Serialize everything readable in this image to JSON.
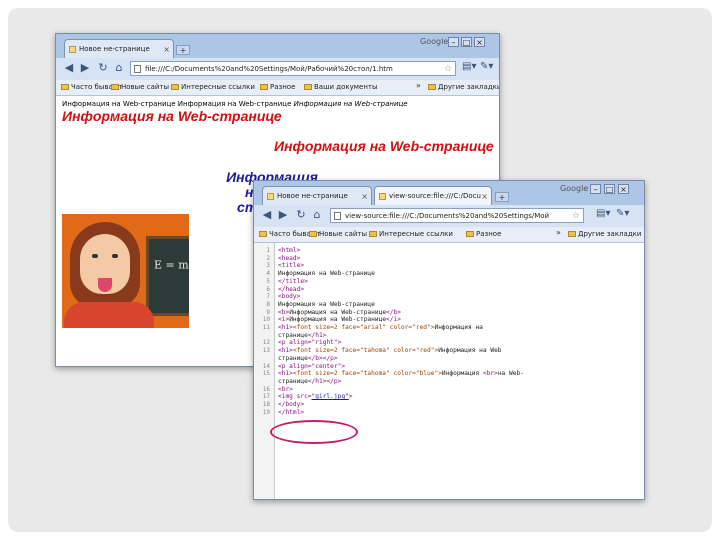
{
  "window1": {
    "tab_title": "Новое не-странице",
    "google": "Google",
    "url": "file:///C:/Documents%20and%20Settings/Мой/Рабочий%20стол/1.htm",
    "bookmarks": [
      "Часто бывают",
      "Новые сайты",
      "Интересные ссылки",
      "Разное",
      "Ваши документы"
    ],
    "bookmarks_other": "Другие закладки",
    "page": {
      "plain_line": "Информация на Web-странице Информация на Web-странице",
      "plain_line_italic": "Информация на Web-странице",
      "heading_red_left": "Информация на Web-странице",
      "heading_red_right": "Информация на Web-странице",
      "heading_blue_1": "Информация",
      "heading_blue_2": "на Web-странице",
      "photo_formula": "E = mc",
      "photo_formula_exp": "2"
    }
  },
  "window2": {
    "tab1_title": "Новое не-странице",
    "tab2_title": "view-source:file:///C:/Docu",
    "google": "Google",
    "url": "view-source:file:///C:/Documents%20and%20Settings/Мой",
    "bookmarks": [
      "Часто бывают",
      "Новые сайты",
      "Интересные ссылки",
      "Разное"
    ],
    "bookmarks_other": "Другие закладки",
    "source_lines": [
      {
        "n": "1",
        "parts": [
          {
            "t": "<html>",
            "c": "tag"
          }
        ]
      },
      {
        "n": "2",
        "parts": [
          {
            "t": "<head>",
            "c": "tag"
          }
        ]
      },
      {
        "n": "3",
        "parts": [
          {
            "t": "<title>",
            "c": "tag"
          }
        ]
      },
      {
        "n": "4",
        "parts": [
          {
            "t": "Информация на Web-странице",
            "c": ""
          }
        ]
      },
      {
        "n": "5",
        "parts": [
          {
            "t": "</title>",
            "c": "tag"
          }
        ]
      },
      {
        "n": "6",
        "parts": [
          {
            "t": "</head>",
            "c": "tag"
          }
        ]
      },
      {
        "n": "7",
        "parts": [
          {
            "t": "<body>",
            "c": "tag"
          }
        ]
      },
      {
        "n": "8",
        "parts": [
          {
            "t": "Информация на Web-странице",
            "c": ""
          }
        ]
      },
      {
        "n": "9",
        "parts": [
          {
            "t": "<b>",
            "c": "tag"
          },
          {
            "t": "Информация на Web-странице",
            "c": ""
          },
          {
            "t": "</b>",
            "c": "tag"
          }
        ]
      },
      {
        "n": "10",
        "parts": [
          {
            "t": "<i>",
            "c": "tag"
          },
          {
            "t": "Информация на Web-странице",
            "c": ""
          },
          {
            "t": "</i>",
            "c": "tag"
          }
        ]
      },
      {
        "n": "11",
        "parts": [
          {
            "t": "<h1>",
            "c": "tag"
          },
          {
            "t": "<font size=2 face=\"arial\" color=\"red\">",
            "c": "attr"
          },
          {
            "t": "Информация на",
            "c": ""
          }
        ]
      },
      {
        "n": "",
        "parts": [
          {
            "t": "странице",
            "c": ""
          },
          {
            "t": "</h1>",
            "c": "tag"
          }
        ]
      },
      {
        "n": "12",
        "parts": [
          {
            "t": "<p align=\"right\">",
            "c": "tag"
          }
        ]
      },
      {
        "n": "13",
        "parts": [
          {
            "t": "<h1>",
            "c": "tag"
          },
          {
            "t": "<font size=2 face=\"tahoma\" color=\"red\">",
            "c": "attr"
          },
          {
            "t": "Информация на Web",
            "c": ""
          }
        ]
      },
      {
        "n": "",
        "parts": [
          {
            "t": "странице",
            "c": ""
          },
          {
            "t": "</b>",
            "c": "tag"
          },
          {
            "t": "</p>",
            "c": "tag"
          }
        ]
      },
      {
        "n": "14",
        "parts": [
          {
            "t": "<p align=\"center\">",
            "c": "tag"
          }
        ]
      },
      {
        "n": "15",
        "parts": [
          {
            "t": "<h1>",
            "c": "tag"
          },
          {
            "t": "<font size=2 face=\"tahoma\" color=\"blue\">",
            "c": "attr"
          },
          {
            "t": "Информация ",
            "c": ""
          },
          {
            "t": "<br>",
            "c": "tag"
          },
          {
            "t": "на Web-",
            "c": ""
          }
        ]
      },
      {
        "n": "",
        "parts": [
          {
            "t": "странице",
            "c": ""
          },
          {
            "t": "</h1>",
            "c": "tag"
          },
          {
            "t": "</p>",
            "c": "tag"
          }
        ]
      },
      {
        "n": "16",
        "parts": [
          {
            "t": "<br>",
            "c": "tag"
          }
        ]
      },
      {
        "n": "17",
        "parts": [
          {
            "t": "<img src=",
            "c": "tag"
          },
          {
            "t": "\"girl.jpg\"",
            "c": "ul"
          },
          {
            "t": ">",
            "c": "tag"
          }
        ]
      },
      {
        "n": "18",
        "parts": [
          {
            "t": "</body>",
            "c": "tag"
          }
        ]
      },
      {
        "n": "19",
        "parts": [
          {
            "t": "</html>",
            "c": "tag"
          }
        ]
      }
    ]
  }
}
